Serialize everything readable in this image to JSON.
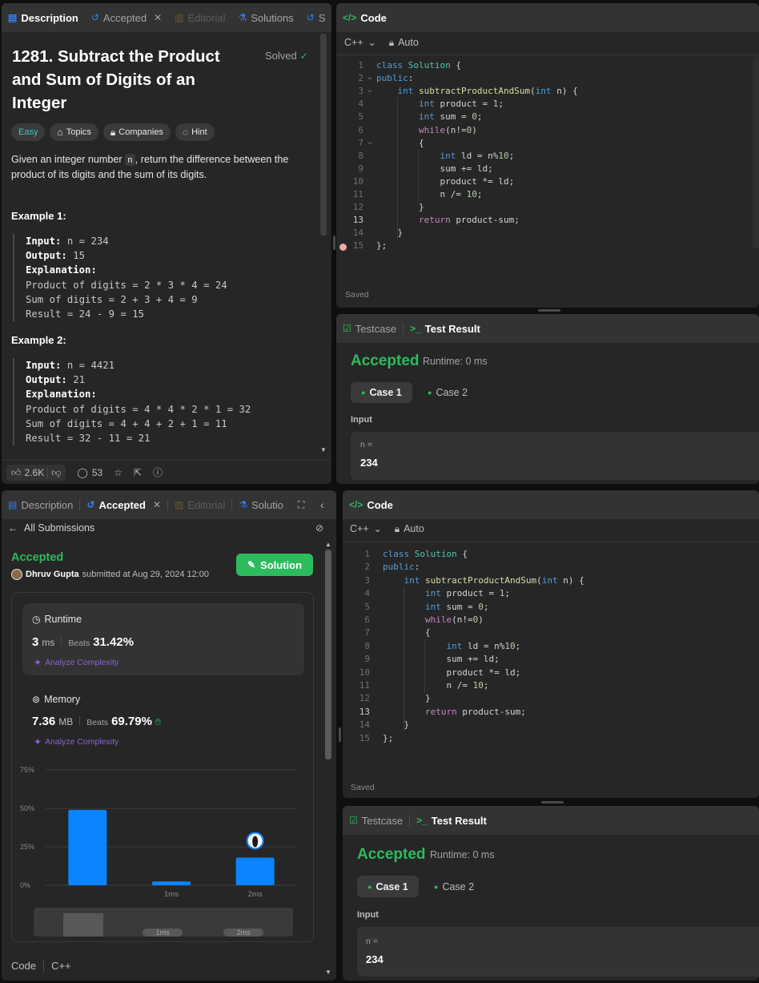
{
  "top_left": {
    "tabs": [
      {
        "label": "Description"
      },
      {
        "label": "Accepted"
      },
      {
        "label": "Editorial"
      },
      {
        "label": "Solutions"
      },
      {
        "label": "S"
      }
    ],
    "title": "1281. Subtract the Product and Sum of Digits of an Integer",
    "title_lines": [
      "1281. Subtract the Product",
      "and Sum of Digits of an",
      "Integer"
    ],
    "solved": "Solved",
    "chips": [
      "Easy",
      "Topics",
      "Companies",
      "Hint"
    ],
    "desc_pre": "Given an integer number ",
    "desc_code": "n",
    "desc_post": ", return the difference between the",
    "desc_line2": "product of its digits and the sum of its digits.",
    "example1": {
      "heading": "Example 1:",
      "input_label": "Input:",
      "input_val": " n = 234",
      "output_label": "Output:",
      "output_val": " 15",
      "expl_label": "Explanation:",
      "lines": [
        "Product of digits = 2 * 3 * 4 = 24",
        "Sum of digits = 2 + 3 + 4 = 9",
        "Result = 24 - 9 = 15"
      ]
    },
    "example2": {
      "heading": "Example 2:",
      "input_label": "Input:",
      "input_val": " n = 4421",
      "output_label": "Output:",
      "output_val": " 21",
      "expl_label": "Explanation:",
      "lines": [
        "Product of digits = 4 * 4 * 2 * 1 = 32",
        "Sum of digits = 4 + 4 + 2 + 1 = 11",
        "Result = 32 - 11 = 21"
      ]
    },
    "likes": "2.6K",
    "comments": "53"
  },
  "code_panel": {
    "title": "Code",
    "language": "C++",
    "mode": "Auto",
    "saved": "Saved",
    "line_numbers": [
      "1",
      "2",
      "3",
      "4",
      "5",
      "6",
      "7",
      "8",
      "9",
      "10",
      "11",
      "12",
      "13",
      "14",
      "15"
    ]
  },
  "test_panel": {
    "tab_testcase": "Testcase",
    "tab_result": "Test Result",
    "status": "Accepted",
    "runtime": "Runtime: 0 ms",
    "case1": "Case 1",
    "case2": "Case 2",
    "input_label": "Input",
    "var_label": "n =",
    "var_value": "234"
  },
  "bottom_left": {
    "tabs": [
      {
        "label": "Description"
      },
      {
        "label": "Accepted"
      },
      {
        "label": "Editorial"
      },
      {
        "label": "Solutio"
      }
    ],
    "back_label": "All Submissions",
    "status": "Accepted",
    "user": "Dhruv Gupta",
    "submitted": "submitted at Aug 29, 2024 12:00",
    "solution_button": "Solution",
    "runtime_title": "Runtime",
    "runtime_value": "3",
    "runtime_unit": "ms",
    "runtime_beats_label": "Beats",
    "runtime_beats": "31.42%",
    "analyze": "Analyze Complexity",
    "memory_title": "Memory",
    "memory_value": "7.36",
    "memory_unit": "MB",
    "memory_beats_label": "Beats",
    "memory_beats": "69.79%",
    "footer_code": "Code",
    "footer_lang": "C++"
  },
  "chart_data": {
    "type": "bar",
    "y_ticks": [
      "75%",
      "50%",
      "25%",
      "0%"
    ],
    "ylim": [
      0,
      75
    ],
    "x_labels": [
      "",
      "1ms",
      "2ms"
    ],
    "values": [
      49,
      2.5,
      18
    ],
    "highlight_index": 2,
    "bar_color": "#0a84ff",
    "minimap_labels": [
      "1ms",
      "2ms"
    ]
  }
}
